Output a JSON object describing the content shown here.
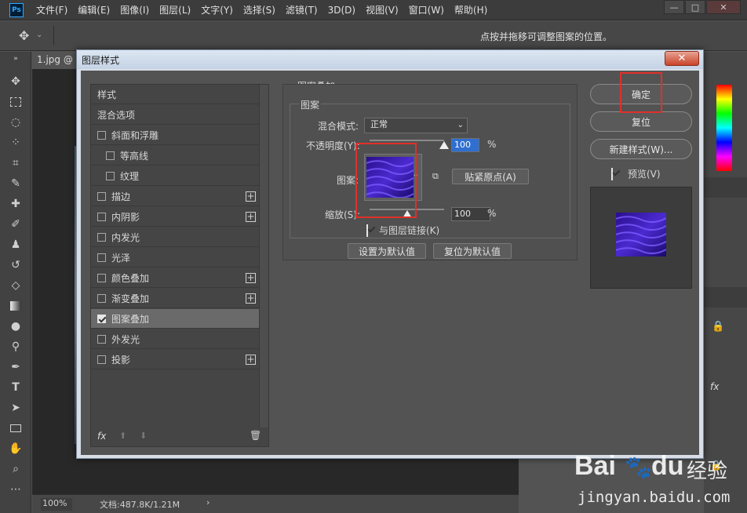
{
  "menubar": {
    "logo": "Ps",
    "items": [
      "文件(F)",
      "编辑(E)",
      "图像(I)",
      "图层(L)",
      "文字(Y)",
      "选择(S)",
      "滤镜(T)",
      "3D(D)",
      "视图(V)",
      "窗口(W)",
      "帮助(H)"
    ],
    "window_buttons": [
      "—",
      "□",
      "✕"
    ]
  },
  "optionsbar": {
    "hint": "点按并拖移可调整图案的位置。"
  },
  "document": {
    "tab_label": "1.jpg @",
    "zoom": "100%",
    "doc_info": "文档:487.8K/1.21M"
  },
  "dialog": {
    "title": "图层样式",
    "close_label": "✕",
    "styles": [
      {
        "label": "样式",
        "checkbox": false,
        "indent": false,
        "plus": false,
        "selected": false
      },
      {
        "label": "混合选项",
        "checkbox": false,
        "indent": false,
        "plus": false,
        "selected": false
      },
      {
        "label": "斜面和浮雕",
        "checkbox": true,
        "checked": false,
        "indent": false,
        "plus": false,
        "selected": false
      },
      {
        "label": "等高线",
        "checkbox": true,
        "checked": false,
        "indent": true,
        "plus": false,
        "selected": false
      },
      {
        "label": "纹理",
        "checkbox": true,
        "checked": false,
        "indent": true,
        "plus": false,
        "selected": false
      },
      {
        "label": "描边",
        "checkbox": true,
        "checked": false,
        "indent": false,
        "plus": true,
        "selected": false
      },
      {
        "label": "内阴影",
        "checkbox": true,
        "checked": false,
        "indent": false,
        "plus": true,
        "selected": false
      },
      {
        "label": "内发光",
        "checkbox": true,
        "checked": false,
        "indent": false,
        "plus": false,
        "selected": false
      },
      {
        "label": "光泽",
        "checkbox": true,
        "checked": false,
        "indent": false,
        "plus": false,
        "selected": false
      },
      {
        "label": "颜色叠加",
        "checkbox": true,
        "checked": false,
        "indent": false,
        "plus": true,
        "selected": false
      },
      {
        "label": "渐变叠加",
        "checkbox": true,
        "checked": false,
        "indent": false,
        "plus": true,
        "selected": false
      },
      {
        "label": "图案叠加",
        "checkbox": true,
        "checked": true,
        "indent": false,
        "plus": false,
        "selected": true
      },
      {
        "label": "外发光",
        "checkbox": true,
        "checked": false,
        "indent": false,
        "plus": false,
        "selected": false
      },
      {
        "label": "投影",
        "checkbox": true,
        "checked": false,
        "indent": false,
        "plus": true,
        "selected": false
      }
    ],
    "footer": {
      "fx": "fx",
      "up": "⬆",
      "down": "⬇",
      "trash": "🗑"
    },
    "pattern_overlay": {
      "group_title": "图案叠加",
      "subgroup_title": "图案",
      "blend_mode_label": "混合模式:",
      "blend_mode_value": "正常",
      "opacity_label": "不透明度(Y):",
      "opacity_value": "100",
      "opacity_fraction": 1.0,
      "percent": "%",
      "pattern_label": "图案:",
      "snap_origin_label": "贴紧原点(A)",
      "scale_label": "缩放(S):",
      "scale_value": "100",
      "scale_fraction": 0.5,
      "link_label": "与图层链接(K)",
      "link_checked": true,
      "set_default_label": "设置为默认值",
      "reset_default_label": "复位为默认值"
    },
    "buttons": {
      "ok": "确定",
      "reset": "复位",
      "new_style": "新建样式(W)...",
      "preview_label": "预览(V)",
      "preview_checked": true
    }
  },
  "watermark": {
    "brand": "Bai",
    "brand2": "du",
    "suffix": "经验",
    "url": "jingyan.baidu.com"
  },
  "colors": {
    "accent_red": "#e0302a",
    "pattern_purple": "#3a1aa8"
  }
}
